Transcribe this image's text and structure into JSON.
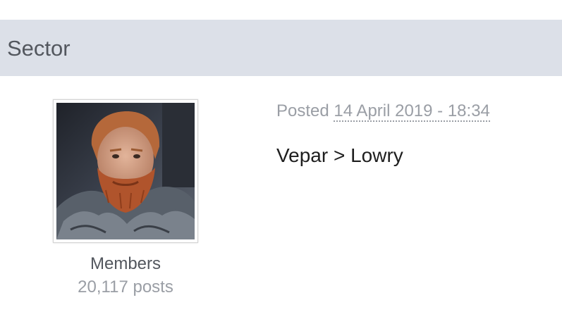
{
  "post": {
    "author": {
      "name": "Sector",
      "group": "Members",
      "post_count": "20,117 posts",
      "avatar_icon": "user-avatar-photo"
    },
    "meta": {
      "posted_label": "Posted",
      "date": "14 April 2019 - 18:34"
    },
    "content": "Vepar > Lowry"
  },
  "colors": {
    "header_bg": "#dce0e8",
    "name_text": "#53575e",
    "muted_text": "#9a9ea5",
    "body_text": "#1e1e1e"
  }
}
